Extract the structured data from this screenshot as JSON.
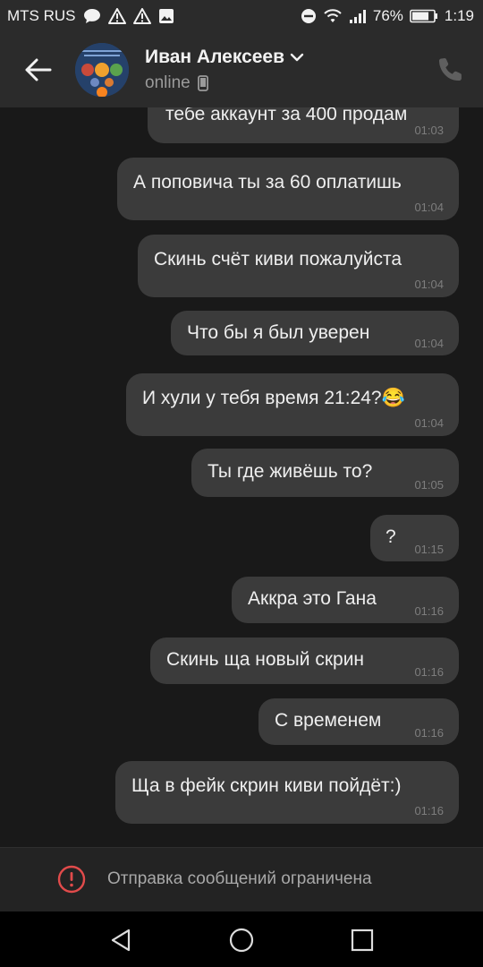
{
  "status_bar": {
    "carrier": "MTS RUS",
    "battery": "76%",
    "time": "1:19",
    "icons": [
      "chat-bubble-icon",
      "warning-icon",
      "warning-icon",
      "image-icon",
      "do-not-disturb-icon",
      "wifi-icon",
      "signal-icon",
      "battery-icon"
    ]
  },
  "header": {
    "contact_name": "Иван Алексеев",
    "presence": "online",
    "icons": [
      "back-arrow-icon",
      "chevron-down-icon",
      "phone-device-icon",
      "call-icon"
    ]
  },
  "messages": [
    {
      "text": "тебе аккаунт за 400 продам",
      "time": "01:03"
    },
    {
      "text": "А поповича ты за 60 оплатишь",
      "time": "01:04"
    },
    {
      "text": "Скинь счёт киви пожалуйста",
      "time": "01:04"
    },
    {
      "text": "Что бы я был уверен",
      "time": "01:04"
    },
    {
      "text": "И хули у тебя время 21:24?😂",
      "time": "01:04"
    },
    {
      "text": "Ты где живёшь то?",
      "time": "01:05"
    },
    {
      "text": "?",
      "time": "01:15"
    },
    {
      "text": "Аккра это Гана",
      "time": "01:16"
    },
    {
      "text": "Скинь ща новый скрин",
      "time": "01:16"
    },
    {
      "text": "С временем",
      "time": "01:16"
    },
    {
      "text": "Ща в фейк скрин киви пойдёт:)",
      "time": "01:16"
    }
  ],
  "restriction": {
    "text": "Отправка сообщений ограничена",
    "color": "#e14b4b"
  },
  "nav_bar": {
    "icons": [
      "nav-back-icon",
      "nav-home-icon",
      "nav-recents-icon"
    ]
  },
  "colors": {
    "background": "#191919",
    "bubble": "#3b3b3b",
    "header": "#2b2b2b"
  }
}
